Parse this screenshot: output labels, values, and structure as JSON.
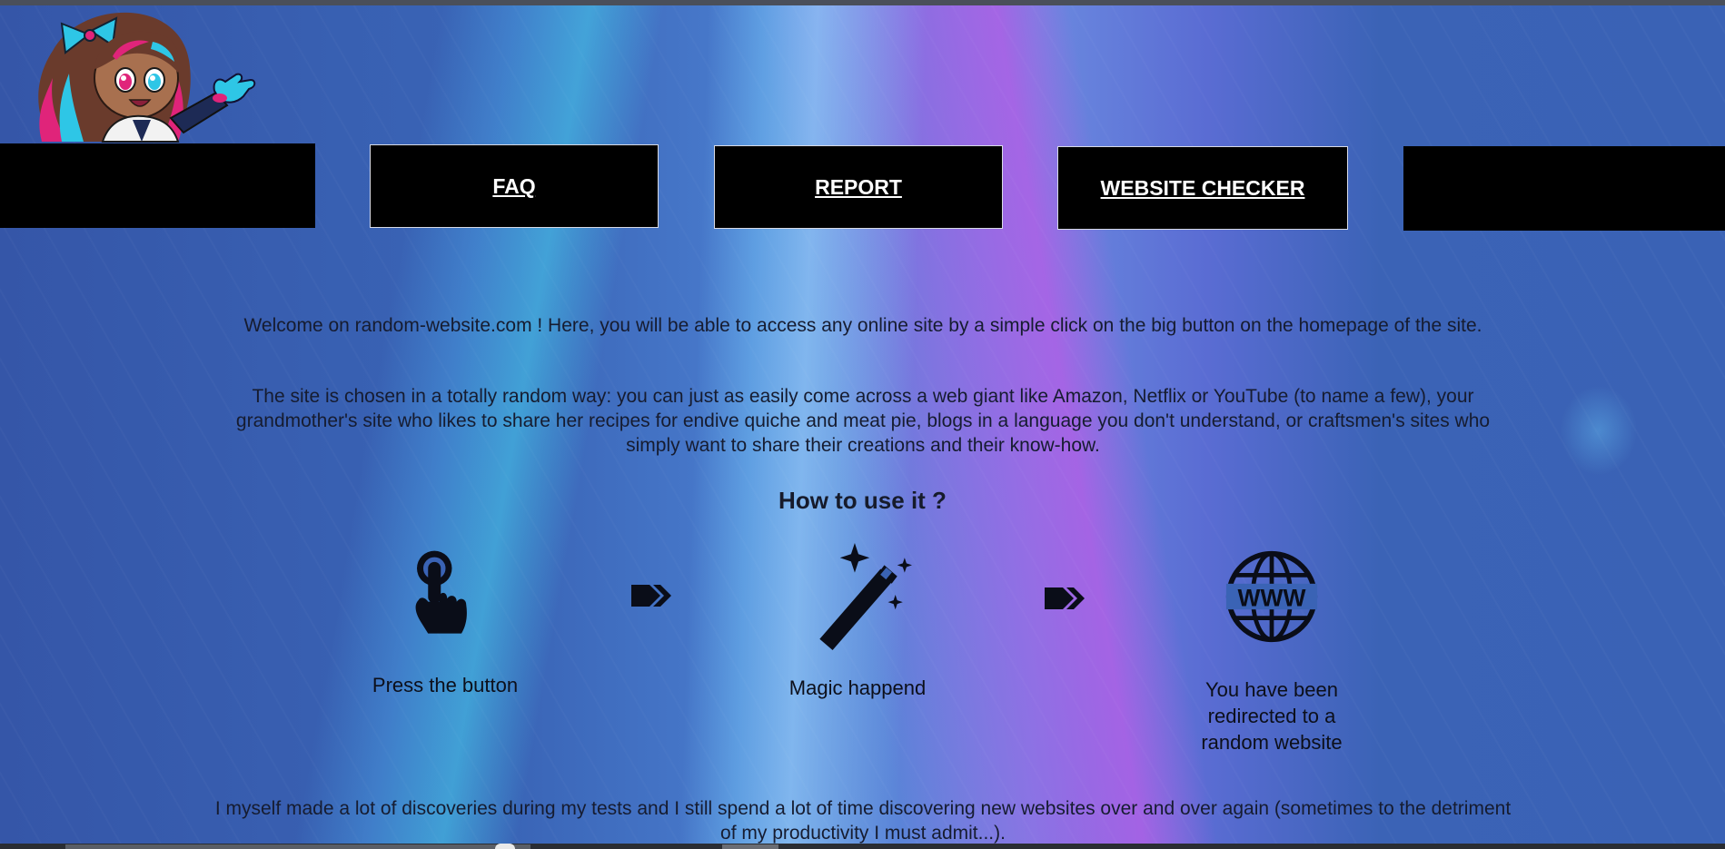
{
  "nav": {
    "faq": "FAQ",
    "report": "REPORT",
    "checker": "WEBSITE CHECKER"
  },
  "intro": {
    "welcome": "Welcome on random-website.com ! Here, you will be able to access any online site by a simple click on the big button on the homepage of the site.",
    "random": "The site is chosen in a totally random way: you can just as easily come across a web giant like Amazon, Netflix or YouTube (to name a few), your grandmother's site who likes to share her recipes for endive quiche and meat pie, blogs in a language you don't understand, or craftsmen's sites who simply want to share their creations and their know-how."
  },
  "how_to": {
    "title": "How to use it ?",
    "steps": [
      {
        "label": "Press the button",
        "icon": "pointer-hand-icon"
      },
      {
        "label": "Magic happend",
        "icon": "magic-wand-icon"
      },
      {
        "label": "You have been redirected to a random website",
        "icon": "www-globe-icon"
      }
    ],
    "arrow_icon": "double-arrow-icon"
  },
  "outro": "I myself made a lot of discoveries during my tests and I still spend a lot of time discovering new websites over and over again (sometimes to the detriment of my productivity I must admit...).",
  "colors": {
    "nav_background": "#000000",
    "nav_text": "#ffffff",
    "page_text": "#161c30"
  }
}
